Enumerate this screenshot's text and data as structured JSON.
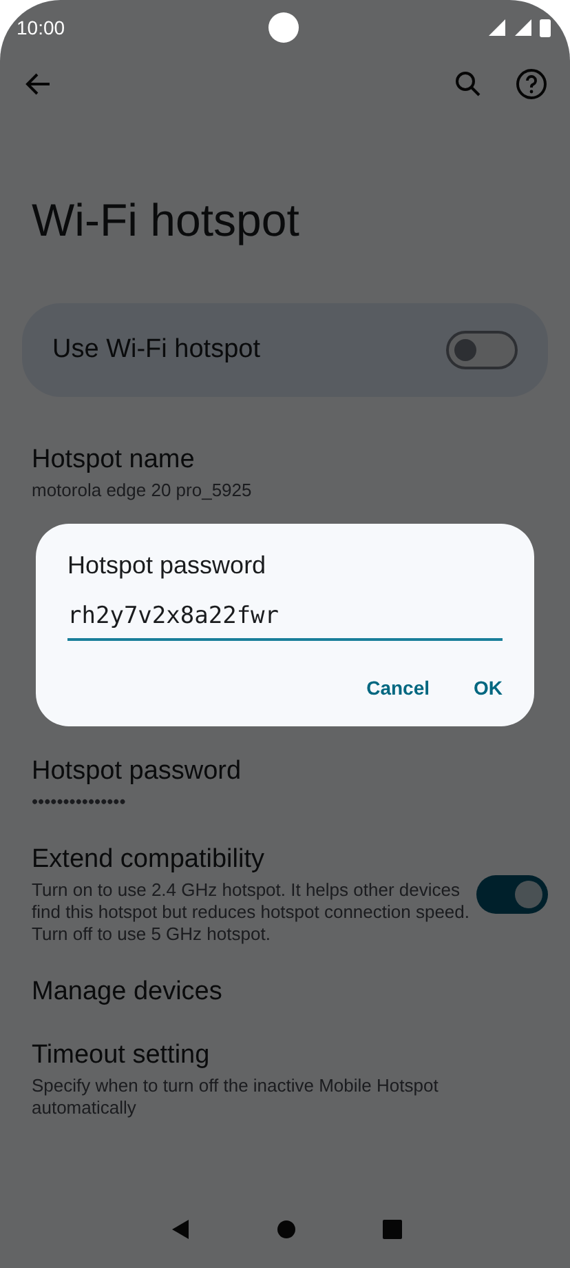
{
  "status_bar": {
    "time": "10:00"
  },
  "title": "Wi-Fi hotspot",
  "main_switch": {
    "label": "Use Wi-Fi hotspot",
    "on": false
  },
  "settings": [
    {
      "kind": "text",
      "title": "Hotspot name",
      "summary": "motorola edge 20 pro_5925"
    },
    {
      "kind": "hidden"
    },
    {
      "kind": "text",
      "title": "Hotspot password",
      "summary": "•••••••••••••••"
    },
    {
      "kind": "switch",
      "title": "Extend compatibility",
      "summary": "Turn on to use 2.4 GHz hotspot. It helps other devices find this hotspot but reduces hotspot connection speed. Turn off to use 5 GHz hotspot.",
      "on": true
    },
    {
      "kind": "text",
      "title": "Manage devices"
    },
    {
      "kind": "text",
      "title": "Timeout setting",
      "summary": "Specify when to turn off the inactive Mobile Hotspot automatically"
    }
  ],
  "dialog": {
    "title": "Hotspot password",
    "value": "rh2y7v2x8a22fwr",
    "buttons": [
      "Cancel",
      "OK"
    ]
  }
}
